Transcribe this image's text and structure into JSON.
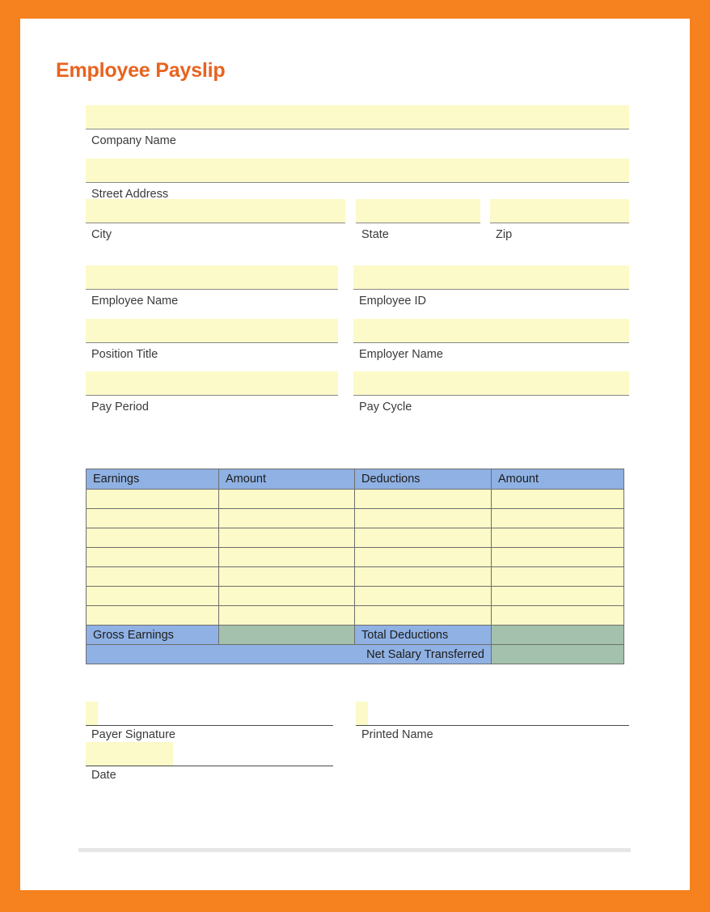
{
  "document": {
    "title": "Employee Payslip",
    "accent_color": "#E8631F",
    "border_color": "#F5821F",
    "field_fill_color": "#FCFAC8",
    "table_header_color": "#8FB1E3",
    "table_total_color": "#A3C1AC"
  },
  "company": {
    "name": {
      "label": "Company Name",
      "value": "",
      "placeholder": ""
    },
    "street": {
      "label": "Street Address",
      "value": "",
      "placeholder": ""
    },
    "city": {
      "label": "City",
      "value": "",
      "placeholder": ""
    },
    "state": {
      "label": "State",
      "value": "",
      "placeholder": ""
    },
    "zip": {
      "label": "Zip",
      "value": "",
      "placeholder": ""
    }
  },
  "employee": {
    "employee_name": {
      "label": "Employee Name",
      "value": "",
      "placeholder": ""
    },
    "employee_id": {
      "label": "Employee ID",
      "value": "",
      "placeholder": ""
    },
    "position_title": {
      "label": "Position Title",
      "value": "",
      "placeholder": ""
    },
    "employer_name": {
      "label": "Employer Name",
      "value": "",
      "placeholder": ""
    },
    "pay_period": {
      "label": "Pay Period",
      "value": "",
      "placeholder": ""
    },
    "pay_cycle": {
      "label": "Pay Cycle",
      "value": "",
      "placeholder": ""
    }
  },
  "pay_table": {
    "headers": [
      "Earnings",
      "Amount",
      "Deductions",
      "Amount"
    ],
    "rows": [
      [
        "",
        "",
        "",
        ""
      ],
      [
        "",
        "",
        "",
        ""
      ],
      [
        "",
        "",
        "",
        ""
      ],
      [
        "",
        "",
        "",
        ""
      ],
      [
        "",
        "",
        "",
        ""
      ],
      [
        "",
        "",
        "",
        ""
      ],
      [
        "",
        "",
        "",
        ""
      ]
    ],
    "totals": {
      "gross_earnings_label": "Gross Earnings",
      "gross_earnings_value": "",
      "total_deductions_label": "Total Deductions",
      "total_deductions_value": "",
      "net_salary_label": "Net Salary Transferred",
      "net_salary_value": ""
    }
  },
  "signatures": {
    "payer_signature": {
      "label": "Payer Signature",
      "value": ""
    },
    "printed_name": {
      "label": "Printed Name",
      "value": ""
    },
    "date": {
      "label": "Date",
      "value": ""
    }
  }
}
